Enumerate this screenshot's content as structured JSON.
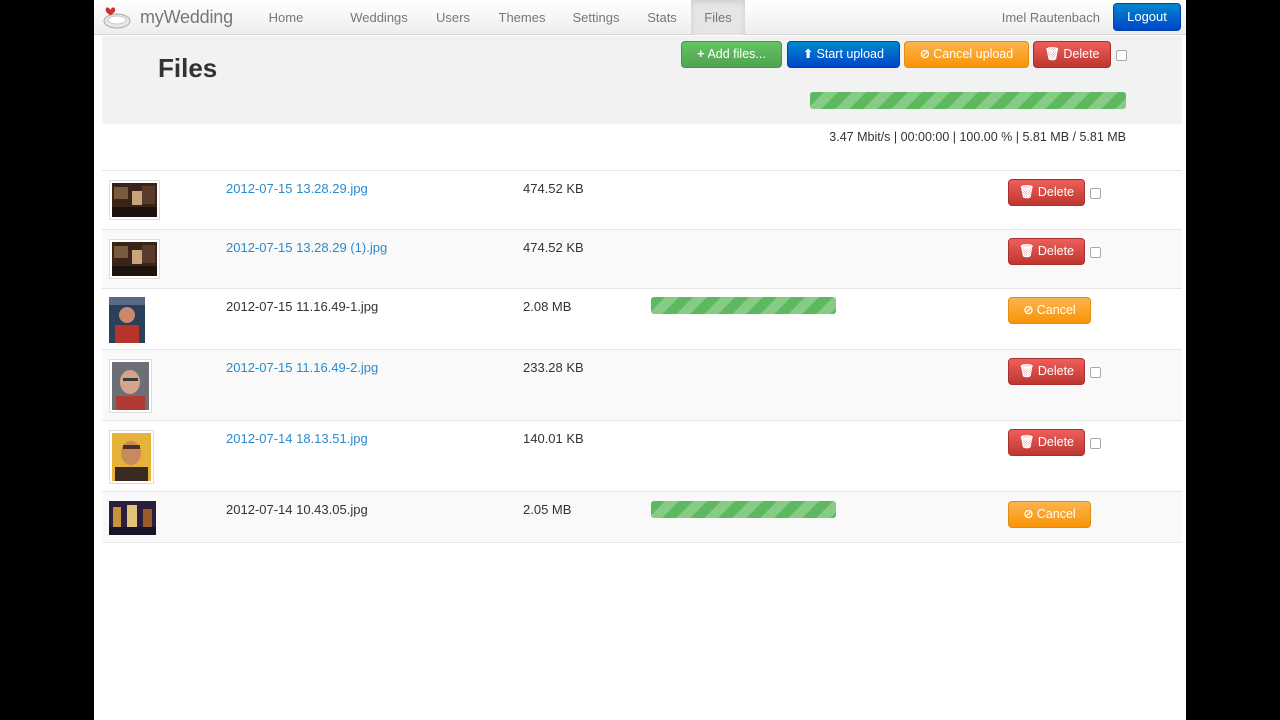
{
  "nav": {
    "brand": "myWedding",
    "items": [
      "Home",
      "Weddings",
      "Users",
      "Themes",
      "Settings",
      "Stats",
      "Files"
    ],
    "active": "Files",
    "user": "Imel Rautenbach",
    "logout": "Logout"
  },
  "header": {
    "title": "Files",
    "buttons": {
      "add_files": "Add files...",
      "start_upload": "Start upload",
      "cancel_upload": "Cancel upload",
      "delete": "Delete"
    },
    "overall_progress_percent": 100,
    "stats": "3.47 Mbit/s | 00:00:00 | 100.00 % | 5.81 MB / 5.81 MB"
  },
  "labels": {
    "delete": "Delete",
    "cancel": "Cancel"
  },
  "files": [
    {
      "name": "2012-07-15 13.28.29.jpg",
      "size": "474.52 KB",
      "status": "uploaded"
    },
    {
      "name": "2012-07-15 13.28.29 (1).jpg",
      "size": "474.52 KB",
      "status": "uploaded"
    },
    {
      "name": "2012-07-15 11.16.49-1.jpg",
      "size": "2.08 MB",
      "status": "uploading",
      "progress_percent": 100
    },
    {
      "name": "2012-07-15 11.16.49-2.jpg",
      "size": "233.28 KB",
      "status": "uploaded"
    },
    {
      "name": "2012-07-14 18.13.51.jpg",
      "size": "140.01 KB",
      "status": "uploaded"
    },
    {
      "name": "2012-07-14 10.43.05.jpg",
      "size": "2.05 MB",
      "status": "uploading",
      "progress_percent": 100
    }
  ],
  "colors": {
    "link": "#2a8bcc",
    "success": "#5eb95e",
    "danger": "#bd362f",
    "warning": "#f89406",
    "primary": "#0044cc"
  },
  "icons": {
    "add": "plus-icon",
    "start": "upload-icon",
    "cancel": "ban-icon",
    "delete": "trash-icon"
  }
}
